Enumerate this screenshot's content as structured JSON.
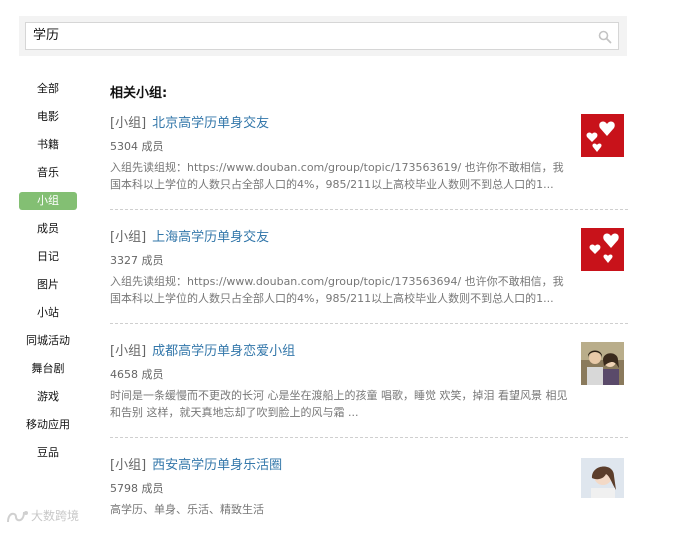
{
  "search": {
    "value": "学历",
    "icon": "search-icon"
  },
  "sidebar": {
    "items": [
      {
        "label": "全部",
        "active": false
      },
      {
        "label": "电影",
        "active": false
      },
      {
        "label": "书籍",
        "active": false
      },
      {
        "label": "音乐",
        "active": false
      },
      {
        "label": "小组",
        "active": true
      },
      {
        "label": "成员",
        "active": false
      },
      {
        "label": "日记",
        "active": false
      },
      {
        "label": "图片",
        "active": false
      },
      {
        "label": "小站",
        "active": false
      },
      {
        "label": "同城活动",
        "active": false
      },
      {
        "label": "舞台剧",
        "active": false
      },
      {
        "label": "游戏",
        "active": false
      },
      {
        "label": "移动应用",
        "active": false
      },
      {
        "label": "豆品",
        "active": false
      }
    ],
    "active_color": "#83bf73"
  },
  "main": {
    "title": "相关小组:",
    "results": [
      {
        "type": "[小组]",
        "title": "北京高学历单身交友",
        "members": "5304 成员",
        "desc": "入组先读组规：https://www.douban.com/group/topic/173563619/ 也许你不敢相信，我国本科以上学位的人数只占全部人口的4%，985/211以上高校毕业人数则不到总人口的1...",
        "thumb": "hearts"
      },
      {
        "type": "[小组]",
        "title": "上海高学历单身交友",
        "members": "3327 成员",
        "desc": "入组先读组规：https://www.douban.com/group/topic/173563694/ 也许你不敢相信，我国本科以上学位的人数只占全部人口的4%，985/211以上高校毕业人数则不到总人口的1...",
        "thumb": "hearts"
      },
      {
        "type": "[小组]",
        "title": "成都高学历单身恋爱小组",
        "members": "4658 成员",
        "desc": "时间是一条缓慢而不更改的长河 心是坐在渡船上的孩童 唱歌，睡觉 欢笑，掉泪 看望风景 相见和告别 这样，就天真地忘却了吹到脸上的风与霜 ...",
        "thumb": "couple"
      },
      {
        "type": "[小组]",
        "title": "西安高学历单身乐活圈",
        "members": "5798 成员",
        "desc": "高学历、单身、乐活、精致生活",
        "thumb": "girl"
      }
    ],
    "link_color": "#3377aa"
  },
  "watermark": {
    "text": "大数跨境"
  }
}
